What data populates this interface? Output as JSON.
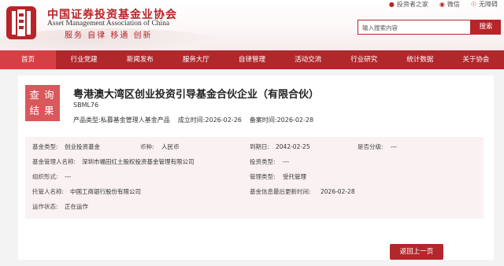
{
  "header": {
    "brand_cn": "中国证券投资基金业协会",
    "brand_en": "Asset Management Association of China",
    "motto": "服务  自律  移通  创新",
    "top_links": [
      {
        "label": "投资者之家",
        "icon": "person-icon"
      },
      {
        "label": "微信",
        "icon": "wechat-icon"
      },
      {
        "label": "无障碍",
        "icon": "accessibility-icon"
      }
    ],
    "search": {
      "placeholder": "输入搜索内容",
      "button": "搜索"
    }
  },
  "nav": {
    "items": [
      "首页",
      "行业党建",
      "新闻发布",
      "服务大厅",
      "自律管理",
      "活动交流",
      "行业研究",
      "统计数据",
      "关于协会"
    ],
    "active_index": 0
  },
  "badge": {
    "line1": "查询",
    "line2": "结果"
  },
  "fund": {
    "title": "粤港澳大湾区创业投资引导基金合伙企业（有限合伙）",
    "code": "SBML76",
    "product_type": "产品类型:私募基金管理人基金产品",
    "established": "成立时间:2026-02-26",
    "filed": "备案时间:2026-02-28"
  },
  "details": {
    "fund_type_label": "基金类型:",
    "fund_type": "创业投资基金",
    "currency_label": "币种:",
    "currency": "人民币",
    "due_label": "到期日:",
    "due": "2042-02-25",
    "graded_label": "是否分级:",
    "graded": "---",
    "manager_label": "基金管理人名称:",
    "manager": "深圳市福田红土股权投资基金管理有限公司",
    "invest_type_label": "投资类型:",
    "invest_type": "---",
    "org_form_label": "组织形式:",
    "org_form": "---",
    "mgmt_type_label": "管理类型:",
    "mgmt_type": "受托管理",
    "custodian_label": "托管人名称:",
    "custodian": "中国工商银行股份有限公司",
    "updated_label": "基金信息最后更新时间:",
    "updated": "2026-02-28",
    "status_label": "运作状态:",
    "status": "正在运作"
  },
  "back_button": "返回上一页",
  "colors": {
    "brand_red": "#b0282c",
    "nav_active": "#d54045",
    "badge": "#d9585b",
    "info_bg": "#faf2f2"
  }
}
